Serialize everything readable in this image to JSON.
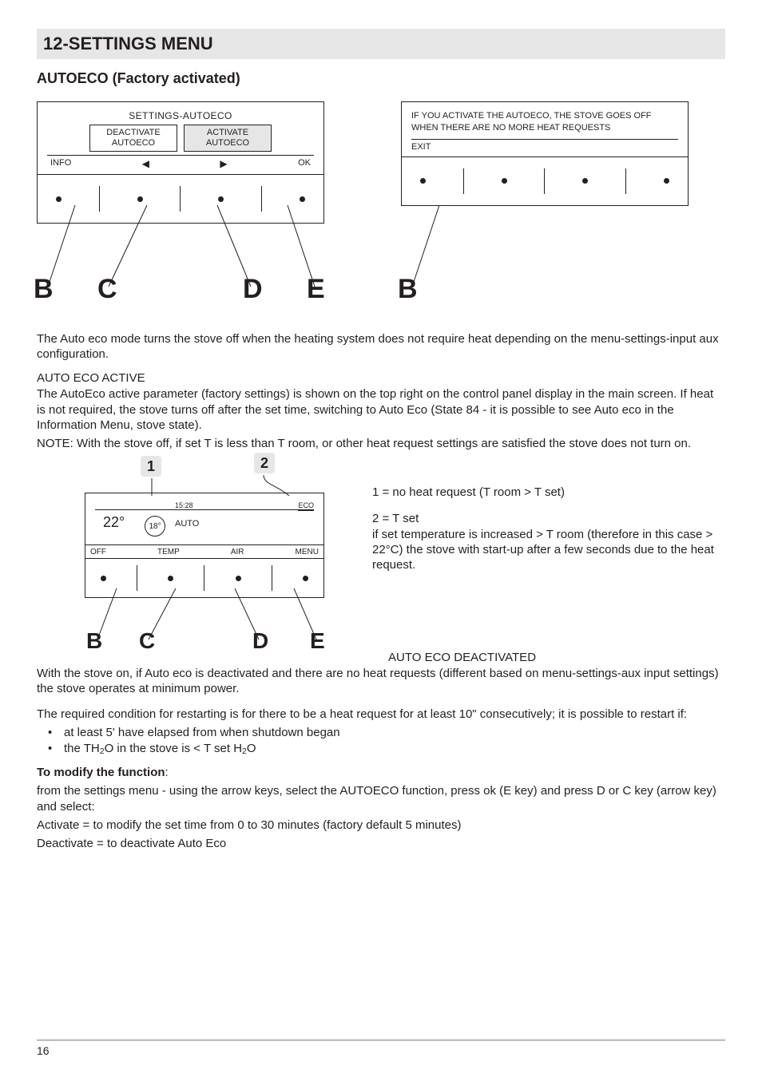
{
  "header": {
    "title": "12-SETTINGS MENU"
  },
  "subhead": "AUTOECO (Factory activated)",
  "panel1": {
    "title": "SETTINGS-AUTOECO",
    "cell_left_l1": "DEACTIVATE",
    "cell_left_l2": "AUTOECO",
    "cell_right_l1": "ACTIVATE",
    "cell_right_l2": "AUTOECO",
    "bottom_left": "INFO",
    "bottom_right": "OK",
    "letters": {
      "b": "B",
      "c": "C",
      "d": "D",
      "e": "E"
    }
  },
  "panel2": {
    "text": "IF YOU ACTIVATE THE AUTOECO, THE STOVE  GOES OFF WHEN THERE ARE NO MORE HEAT REQUESTS",
    "bottom_left": "EXIT",
    "letters": {
      "b": "B"
    }
  },
  "para1": "The Auto eco mode turns the stove off when the heating system does not require heat depending on the menu-settings-input aux configuration.",
  "para2_head": "AUTO ECO ACTIVE",
  "para2": "The AutoEco active parameter (factory settings) is shown on the top right on the control panel display in the main screen. If heat is not required, the stove turns off after the set time, switching to Auto Eco (State 84 - it is possible to see Auto eco in the Information Menu, stove state).",
  "para3": "NOTE: With the stove off, if set T is less than T room, or other heat request settings are satisfied the stove does not turn on.",
  "panel3": {
    "callout1": "1",
    "callout2": "2",
    "time": "15:28",
    "eco": "ECO",
    "temp": "22°",
    "circ": "18°",
    "auto": "AUTO",
    "bottom": {
      "off": "OFF",
      "temp": "TEMP",
      "air": "AIR",
      "menu": "MENU"
    },
    "letters": {
      "b": "B",
      "c": "C",
      "d": "D",
      "e": "E"
    }
  },
  "right_block": {
    "l1": "1 = no heat request (T room > T set)",
    "l2": "2 = T set",
    "l3": "if set temperature is increased > T room (therefore in this case > 22°C) the stove with start-up after a few seconds due to the heat request."
  },
  "para4_head": "AUTO ECO DEACTIVATED",
  "para4": "With the stove on, if Auto eco is deactivated and there are no heat requests (different based on menu-settings-aux input settings) the stove operates at minimum power.",
  "para5": "The required condition for restarting is for there to be a heat request for at least 10\" consecutively; it is possible to restart if:",
  "bullets": {
    "b1": "at least 5' have elapsed from when shutdown began",
    "b2_pre": "the TH",
    "b2_mid": "O in the stove is < T set H",
    "b2_suf": "O"
  },
  "mod_head": "To modify the function",
  "mod_colon": ":",
  "mod_l1": "from the settings menu - using the arrow keys, select the AUTOECO function, press ok (E key) and press D or C key (arrow key) and select:",
  "mod_l2": "Activate = to modify the set time from 0 to 30 minutes (factory default 5 minutes)",
  "mod_l3": "Deactivate = to deactivate Auto Eco",
  "page_number": "16"
}
